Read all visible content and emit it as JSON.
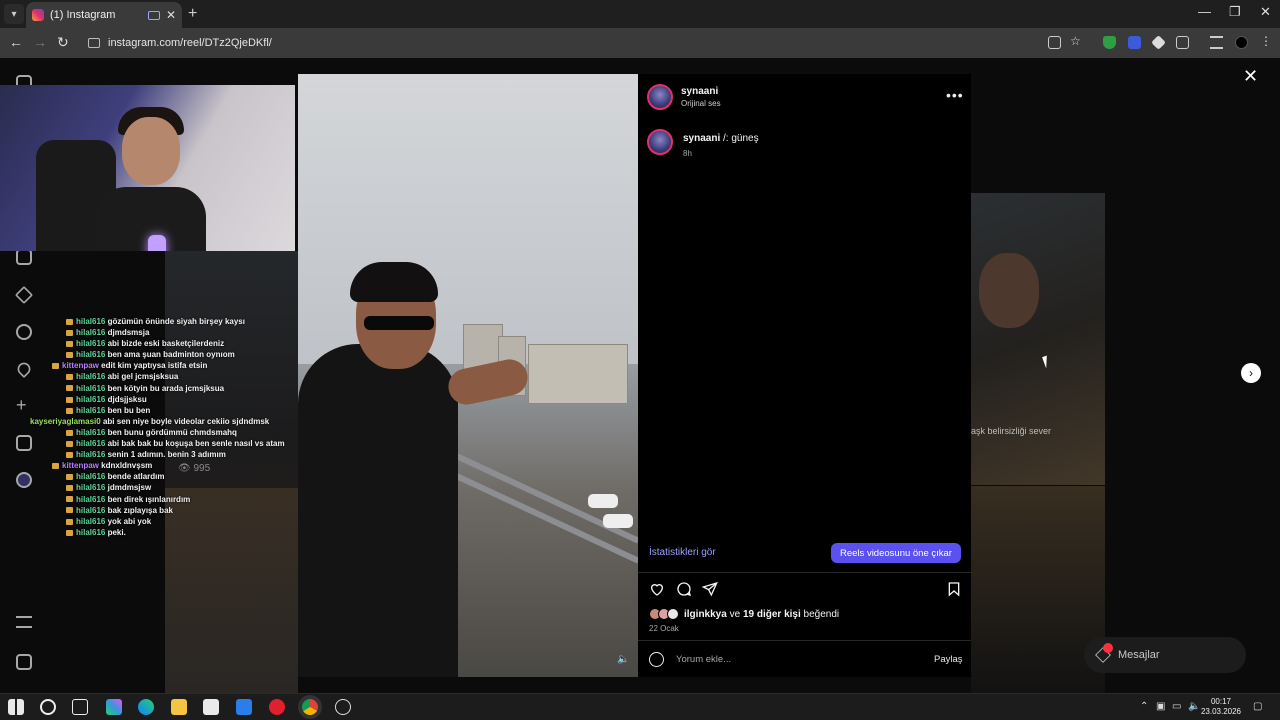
{
  "browser": {
    "tab_title": "(1) Instagram",
    "new_tab": "+",
    "url": "instagram.com/reel/DTz2QjeDKfl/",
    "win_min": "—",
    "win_restore": "❐",
    "win_close": "✕"
  },
  "stream": {
    "view_count": "995",
    "chat": [
      {
        "user": "hilal616",
        "color": "green",
        "msg": "gözümün önünde siyah birşey kaysı"
      },
      {
        "user": "hilal616",
        "color": "green",
        "msg": "djmdsmsja"
      },
      {
        "user": "hilal616",
        "color": "green",
        "msg": "abi bizde eski basketçilerdeniz"
      },
      {
        "user": "hilal616",
        "color": "green",
        "msg": "ben ama şuan badminton oynıom"
      },
      {
        "user": "kittenpaw",
        "color": "purple",
        "msg": "edit kim yaptıysa istifa etsin"
      },
      {
        "user": "hilal616",
        "color": "green",
        "msg": "abi gel jcmsjsksua"
      },
      {
        "user": "hilal616",
        "color": "green",
        "msg": "ben kötyin bu arada jcmsjksua"
      },
      {
        "user": "hilal616",
        "color": "green",
        "msg": "djdsjjsksu"
      },
      {
        "user": "hilal616",
        "color": "green",
        "msg": "ben bu ben"
      },
      {
        "user": "kayseriyaglamasi0",
        "color": "lime",
        "msg": "abi sen niye boyle videolar cekiio sjdndmsk"
      },
      {
        "user": "hilal616",
        "color": "green",
        "msg": "ben bunu gördümmü chmdsmahq"
      },
      {
        "user": "hilal616",
        "color": "green",
        "msg": "abi bak bak bu koşuşa ben senle nasıl vs atam"
      },
      {
        "user": "hilal616",
        "color": "green",
        "msg": "senin 1 adımın. benin 3 adımım"
      },
      {
        "user": "kittenpaw",
        "color": "purple",
        "msg": "kdnxldnvşsm"
      },
      {
        "user": "hilal616",
        "color": "green",
        "msg": "bende atlardım"
      },
      {
        "user": "hilal616",
        "color": "green",
        "msg": "jdmdmsjsw"
      },
      {
        "user": "hilal616",
        "color": "green",
        "msg": "ben direk ışınlanırdım"
      },
      {
        "user": "hilal616",
        "color": "green",
        "msg": "bak zıplayışa bak"
      },
      {
        "user": "hilal616",
        "color": "green",
        "msg": "yok abi yok"
      },
      {
        "user": "hilal616",
        "color": "green",
        "msg": "peki."
      }
    ]
  },
  "post": {
    "username": "synaani",
    "audio": "Orijinal ses",
    "more": "•••",
    "caption_user": "synaani",
    "caption_text": " /: güneş",
    "caption_time": "8h",
    "stats_link": "İstatistikleri gör",
    "boost_button": "Reels videosunu öne çıkar",
    "likes_user": "ilginkkya",
    "likes_mid": " ve ",
    "likes_others": "19 diğer kişi",
    "likes_end": " beğendi",
    "date": "22 Ocak",
    "comment_placeholder": "Yorum ekle...",
    "share_label": "Paylaş"
  },
  "right_caption": "aşk belirsizliği sever",
  "messages_label": "Mesajlar",
  "taskbar": {
    "time": "00:17",
    "date": "23.03.2026"
  },
  "colors": {
    "boost_button": "#5b51f0",
    "stats_link": "#9aa0ff",
    "notification": "#ff3040"
  }
}
